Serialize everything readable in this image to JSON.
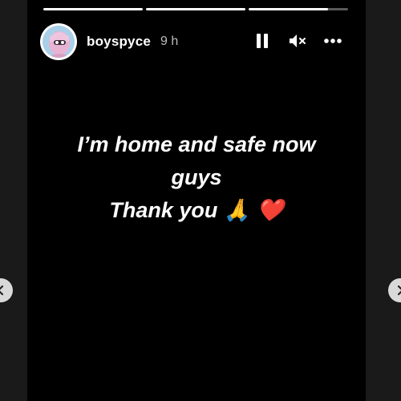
{
  "story": {
    "progress": [
      1.0,
      1.0,
      0.8
    ],
    "user": {
      "username": "boyspyce",
      "timestamp": "9 h"
    },
    "controls": {
      "pause_icon": "pause-icon",
      "mute_icon": "speaker-muted-icon",
      "more_icon": "more-horizontal-icon"
    },
    "caption": {
      "line1": "I’m home and safe now",
      "line2": "guys",
      "line3": "Thank you 🙏 ❤️"
    }
  },
  "navigation": {
    "prev_icon": "chevron-left-icon",
    "next_icon": "chevron-right-icon"
  }
}
